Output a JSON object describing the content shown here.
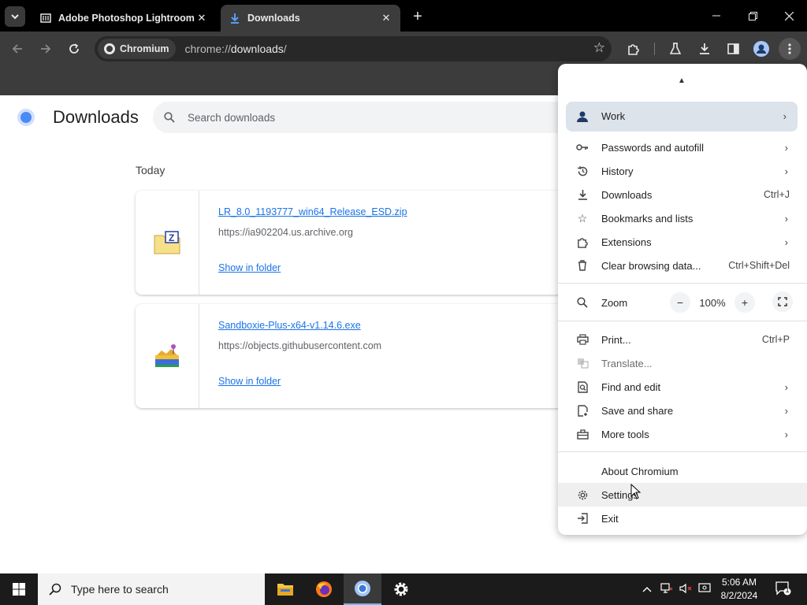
{
  "browser": {
    "tabs": [
      {
        "title": "Adobe Photoshop Lightroom C",
        "active": false
      },
      {
        "title": "Downloads",
        "active": true
      }
    ],
    "site_chip": "Chromium",
    "url_prefix": "chrome://",
    "url_host": "downloads",
    "url_suffix": "/"
  },
  "downloads": {
    "title": "Downloads",
    "search_placeholder": "Search downloads",
    "section": "Today",
    "items": [
      {
        "name": "LR_8.0_1193777_win64_Release_ESD.zip",
        "source": "https://ia902204.us.archive.org",
        "action": "Show in folder",
        "icon": "archive-file-icon"
      },
      {
        "name": "Sandboxie-Plus-x64-v1.14.6.exe",
        "source": "https://objects.githubusercontent.com",
        "action": "Show in folder",
        "icon": "sandboxie-app-icon"
      }
    ]
  },
  "menu": {
    "profile": "Work",
    "items": [
      {
        "label": "Passwords and autofill",
        "shortcut": "",
        "icon": "key-icon"
      },
      {
        "label": "History",
        "shortcut": "",
        "icon": "history-icon"
      },
      {
        "label": "Downloads",
        "shortcut": "Ctrl+J",
        "icon": "download-icon"
      },
      {
        "label": "Bookmarks and lists",
        "shortcut": "",
        "icon": "star-icon"
      },
      {
        "label": "Extensions",
        "shortcut": "",
        "icon": "puzzle-icon"
      },
      {
        "label": "Clear browsing data...",
        "shortcut": "Ctrl+Shift+Del",
        "icon": "trash-icon"
      }
    ],
    "zoom_label": "Zoom",
    "zoom_value": "100%",
    "items2": [
      {
        "label": "Print...",
        "shortcut": "Ctrl+P",
        "icon": "printer-icon"
      },
      {
        "label": "Translate...",
        "shortcut": "",
        "icon": "translate-icon"
      },
      {
        "label": "Find and edit",
        "shortcut": "",
        "icon": "find-icon"
      },
      {
        "label": "Save and share",
        "shortcut": "",
        "icon": "save-icon"
      },
      {
        "label": "More tools",
        "shortcut": "",
        "icon": "toolbox-icon"
      }
    ],
    "about": "About Chromium",
    "settings": "Settings",
    "exit": "Exit"
  },
  "taskbar": {
    "search_placeholder": "Type here to search",
    "time": "5:06 AM",
    "date": "8/2/2024",
    "notifications": "1"
  }
}
